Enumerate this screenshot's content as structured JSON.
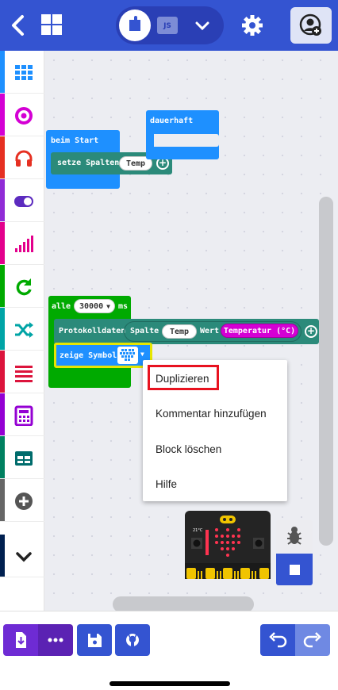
{
  "header": {
    "js_label": "JS",
    "colors": {
      "header": "#3454d1",
      "toggle": "#2a3fb5"
    },
    "icons": [
      "back-icon",
      "home-grid-icon",
      "blocks-icon",
      "chevron-down-icon",
      "gear-icon",
      "user-add-icon"
    ]
  },
  "toolbox": {
    "categories": [
      {
        "name": "grid-icon",
        "color": "#1e90ff"
      },
      {
        "name": "target-icon",
        "color": "#d400d4"
      },
      {
        "name": "headphones-icon",
        "color": "#e63022"
      },
      {
        "name": "toggle-icon",
        "color": "#902bd6"
      },
      {
        "name": "signal-icon",
        "color": "#e3008c"
      },
      {
        "name": "refresh-icon",
        "color": "#00aa00"
      },
      {
        "name": "shuffle-icon",
        "color": "#00a4a6"
      },
      {
        "name": "list-icon",
        "color": "#dc143c"
      },
      {
        "name": "calculator-icon",
        "color": "#9400d3"
      },
      {
        "name": "table-icon",
        "color": "#008060"
      },
      {
        "name": "add-icon",
        "color": "#666666"
      },
      {
        "name": "chevron-down-icon",
        "color": "#002050"
      }
    ]
  },
  "blocks": {
    "on_start": "beim Start",
    "set_columns": "setze Spalten",
    "temp": "Temp",
    "forever": "dauerhaft",
    "every": "alle",
    "every_value": "30000",
    "every_unit": "ms",
    "log_data": "Protokolldaten",
    "column": "Spalte",
    "value": "Wert",
    "temperature": "Temperatur (°C)",
    "show_icon": "zeige Symbol",
    "colors": {
      "basic": "#1e90ff",
      "loops": "#00aa00",
      "logging": "#2b8a7a",
      "input": "#d400d4",
      "highlight": "#e6e600"
    }
  },
  "context_menu": {
    "items": [
      "Duplizieren",
      "Kommentar hinzufügen",
      "Block löschen",
      "Hilfe"
    ],
    "highlighted": "Duplizieren",
    "highlight_color": "#e8121f"
  },
  "simulator": {
    "temperature_label": "21°C",
    "colors": {
      "board": "#242424",
      "led": "#ff3350"
    }
  },
  "bottom_bar": {
    "colors": {
      "purple": "#6e2bd4",
      "blue": "#3454d1"
    },
    "icons": [
      "download-icon",
      "more-icon",
      "save-icon",
      "github-icon",
      "undo-icon",
      "redo-icon"
    ]
  }
}
